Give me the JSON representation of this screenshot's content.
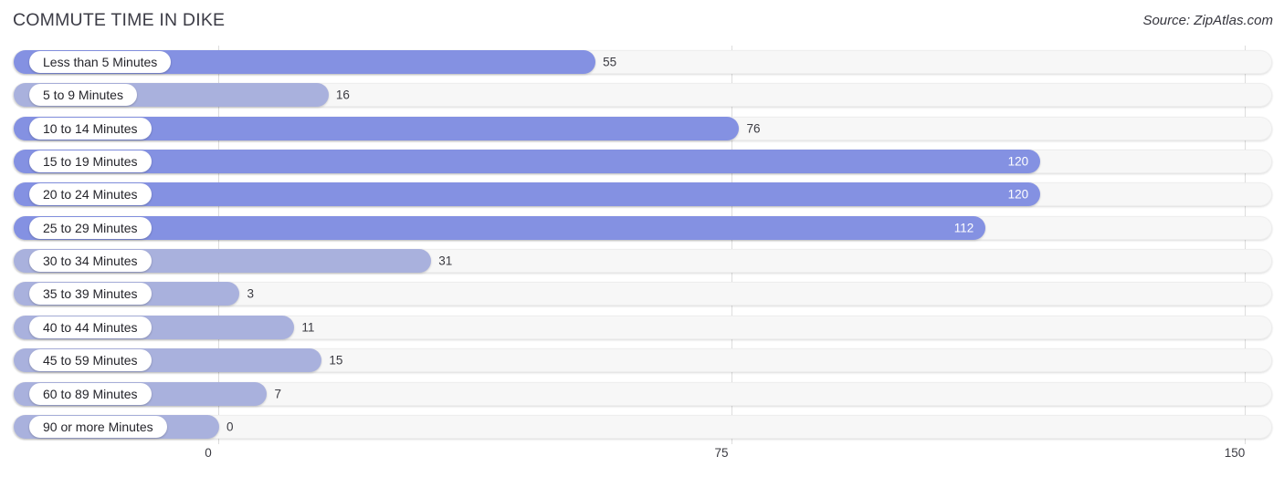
{
  "header": {
    "title": "COMMUTE TIME IN DIKE",
    "source": "Source: ZipAtlas.com"
  },
  "axis": {
    "ticks": [
      "0",
      "75",
      "150"
    ]
  },
  "chart_data": {
    "type": "bar",
    "orientation": "horizontal",
    "title": "COMMUTE TIME IN DIKE",
    "subtitle": "Source: ZipAtlas.com",
    "xlabel": "",
    "ylabel": "",
    "xlim": [
      0,
      150
    ],
    "xticks": [
      0,
      75,
      150
    ],
    "grid": true,
    "legend": false,
    "accent_color": "#8491e2",
    "accent_color_light": "#a9b1dd",
    "track_color": "#f7f7f7",
    "categories": [
      "Less than 5 Minutes",
      "5 to 9 Minutes",
      "10 to 14 Minutes",
      "15 to 19 Minutes",
      "20 to 24 Minutes",
      "25 to 29 Minutes",
      "30 to 34 Minutes",
      "35 to 39 Minutes",
      "40 to 44 Minutes",
      "45 to 59 Minutes",
      "60 to 89 Minutes",
      "90 or more Minutes"
    ],
    "values": [
      55,
      16,
      76,
      120,
      120,
      112,
      31,
      3,
      11,
      15,
      7,
      0
    ],
    "value_labels": [
      "55",
      "16",
      "76",
      "120",
      "120",
      "112",
      "31",
      "3",
      "11",
      "15",
      "7",
      "0"
    ],
    "label_placement": [
      "outside",
      "outside",
      "outside",
      "inside",
      "inside",
      "inside",
      "outside",
      "outside",
      "outside",
      "outside",
      "outside",
      "outside"
    ],
    "bar_shade": [
      "dark",
      "light",
      "dark",
      "dark",
      "dark",
      "dark",
      "light",
      "light",
      "light",
      "light",
      "light",
      "light"
    ]
  }
}
